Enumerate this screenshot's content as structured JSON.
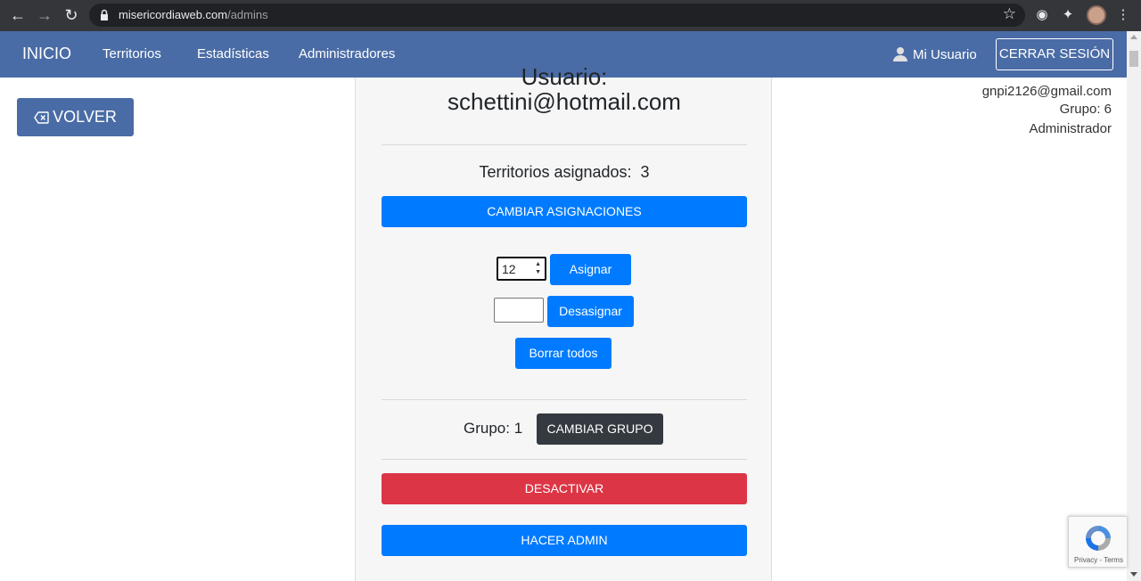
{
  "browser": {
    "url_host": "misericordiaweb.com",
    "url_path": "/admins"
  },
  "navbar": {
    "brand": "INICIO",
    "links": [
      "Territorios",
      "Estadísticas",
      "Administradores"
    ],
    "user_label": "Mi Usuario",
    "logout_label": "CERRAR SESIÓN"
  },
  "back_button": {
    "label": "VOLVER"
  },
  "current_user": {
    "email": "gnpi2126@gmail.com",
    "group": "Grupo: 6",
    "role": "Administrador"
  },
  "card": {
    "title_line1": "Usuario:",
    "title_line2": "schettini@hotmail.com",
    "territories_label": "Territorios asignados:",
    "territories_count": "3",
    "change_assignments_label": "CAMBIAR ASIGNACIONES",
    "assign_input_value": "12",
    "assign_label": "Asignar",
    "unassign_label": "Desasignar",
    "clear_all_label": "Borrar todos",
    "group_label": "Grupo: 1",
    "change_group_label": "CAMBIAR GRUPO",
    "deactivate_label": "DESACTIVAR",
    "make_admin_label": "HACER ADMIN"
  },
  "recaptcha": {
    "terms": "Privacy - Terms"
  },
  "colors": {
    "navbar": "#4a6ca6",
    "primary": "#007bff",
    "danger": "#dc3545",
    "dark": "#343a40"
  }
}
